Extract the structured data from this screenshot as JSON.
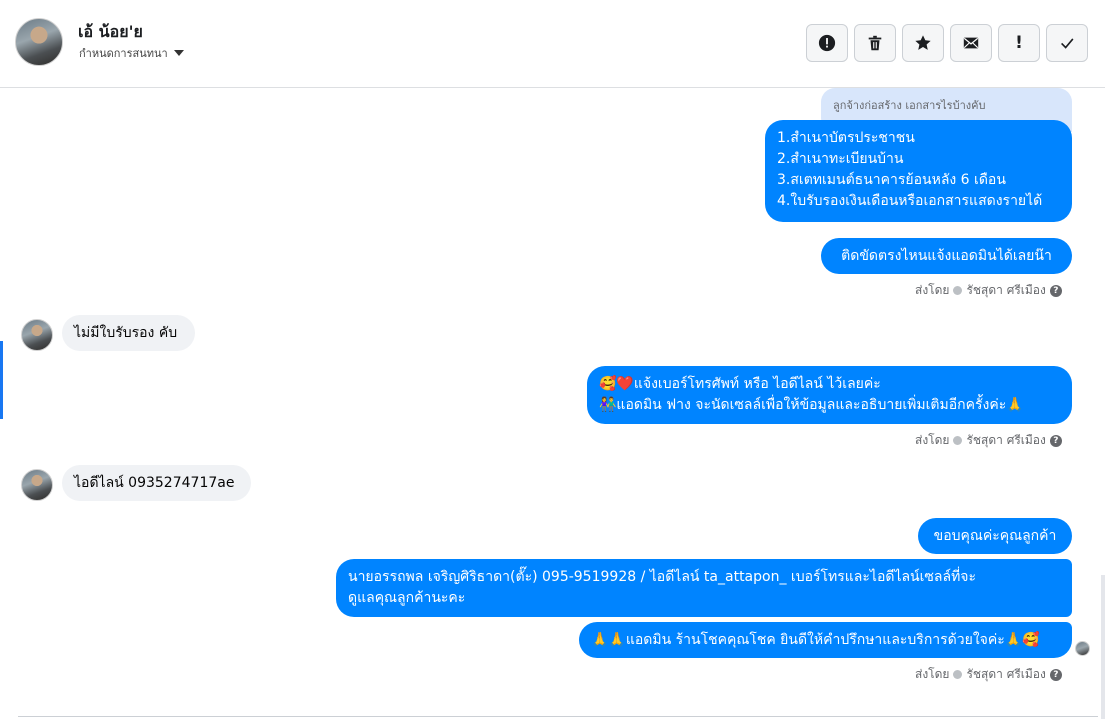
{
  "header": {
    "contact_name": "เอ้ น้อย'ย",
    "subtitle": "กำหนดการสนทนา",
    "toolbar": [
      {
        "name": "alert-circle",
        "label": ""
      },
      {
        "name": "trash",
        "label": ""
      },
      {
        "name": "star",
        "label": ""
      },
      {
        "name": "envelope",
        "label": ""
      },
      {
        "name": "exclamation",
        "label": "!"
      },
      {
        "name": "checkmark",
        "label": ""
      }
    ]
  },
  "messages": {
    "quote_text": "ลูกจ้างก่อสร้าง เอกสารไรบ้างคับ",
    "docs_list": [
      "1.สำเนาบัตรประชาชน",
      "2.สำเนาทะเบียนบ้าน",
      "3.สเตทเมนต์ธนาคารย้อนหลัง 6 เดือน",
      "4.ใบรับรองเงินเดือนหรือเอกสารแสดงรายได้"
    ],
    "notify_admin": "ติดขัดตรงไหนแจ้งแอดมินได้เลยน๊า",
    "no_certificate": "ไม่มีใบรับรอง คับ",
    "ask_phone_line1": "🥰❤️แจ้งเบอร์โทรศัพท์ หรือ ไอดีไลน์  ไว้เลยค่ะ",
    "ask_phone_line2": "👫แอดมิน ฟาง จะนัดเซลล์เพื่อให้ข้อมูลและอธิบายเพิ่มเติมอีกครั้งค่ะ🙏",
    "line_id": "ไอดีไลน์ 0935274717ae",
    "thanks": "ขอบคุณค่ะคุณลูกค้า",
    "seller_line1": "นายอรรถพล เจริญศิริธาดา(ตั๊ะ)       095-9519928 / ไอดีไลน์ ta_attapon_  เบอร์โทรและไอดีไลน์เซลล์ที่จะ",
    "seller_line2": "ดูแลคุณลูกค้านะคะ",
    "closing": "🙏🙏แอดมิน ร้านโชคคุณโชค ยินดีให้คำปรึกษาและบริการด้วยใจค่ะ🙏🥰"
  },
  "sent_by": {
    "prefix": "ส่งโดย",
    "agent": "รัชสุดา ศรีเมือง",
    "help": "?"
  },
  "colors": {
    "outgoing": "#0084ff",
    "incoming": "#f0f2f5",
    "quote": "#d8e6fb",
    "accent": "#1877f2"
  }
}
